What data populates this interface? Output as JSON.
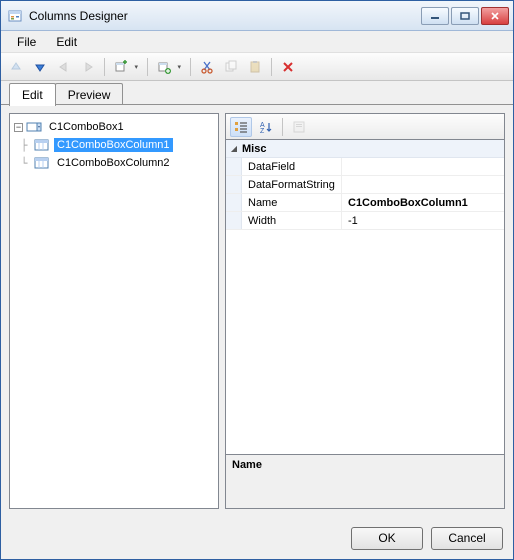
{
  "window": {
    "title": "Columns Designer"
  },
  "menubar": {
    "file": "File",
    "edit": "Edit"
  },
  "tabs": {
    "edit": "Edit",
    "preview": "Preview"
  },
  "tree": {
    "root": "C1ComboBox1",
    "child0": "C1ComboBoxColumn1",
    "child1": "C1ComboBoxColumn2"
  },
  "props": {
    "category": "Misc",
    "rows": {
      "datafield": {
        "key": "DataField",
        "val": ""
      },
      "dataformat": {
        "key": "DataFormatString",
        "val": ""
      },
      "name": {
        "key": "Name",
        "val": "C1ComboBoxColumn1"
      },
      "width": {
        "key": "Width",
        "val": "-1"
      }
    }
  },
  "desc": {
    "title": "Name"
  },
  "buttons": {
    "ok": "OK",
    "cancel": "Cancel"
  }
}
